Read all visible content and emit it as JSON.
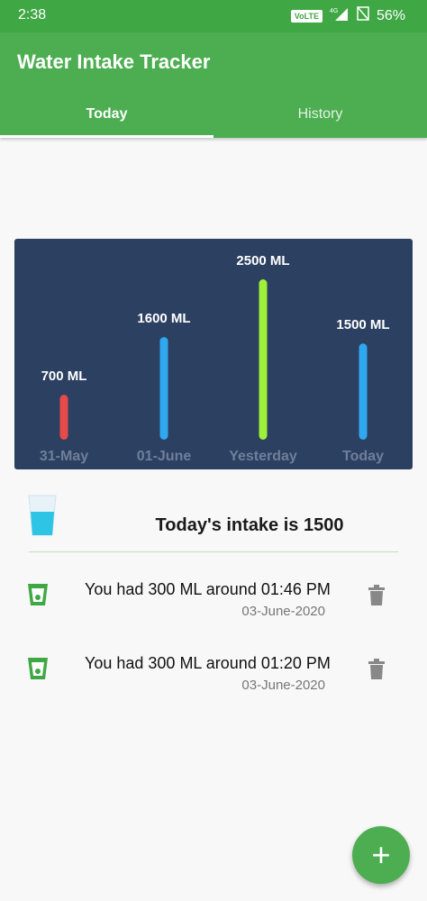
{
  "status_bar": {
    "time": "2:38",
    "volte": "VoLTE",
    "network": "4G",
    "battery": "56%"
  },
  "app": {
    "title": "Water Intake Tracker"
  },
  "tabs": [
    {
      "label": "Today",
      "active": true
    },
    {
      "label": "History",
      "active": false
    }
  ],
  "chart_data": {
    "type": "bar",
    "categories": [
      "31-May",
      "01-June",
      "Yesterday",
      "Today"
    ],
    "values": [
      700,
      1600,
      2500,
      1500
    ],
    "value_labels": [
      "700 ML",
      "1600 ML",
      "2500 ML",
      "1500 ML"
    ],
    "colors": [
      "#e84a4a",
      "#2fa8f0",
      "#9ef03a",
      "#2fa8f0"
    ],
    "ylim": [
      0,
      2500
    ],
    "grid": false,
    "background": "#2c4062"
  },
  "summary": {
    "intake_text": "Today's intake is 1500"
  },
  "entries": [
    {
      "message": "You had 300 ML around 01:46 PM",
      "date": "03-June-2020"
    },
    {
      "message": "You had 300 ML around 01:20 PM",
      "date": "03-June-2020"
    }
  ],
  "fab": {
    "label": "+"
  },
  "colors": {
    "primary": "#4cae50",
    "status_bar": "#3fa845",
    "accent_text": "#ffffff"
  }
}
